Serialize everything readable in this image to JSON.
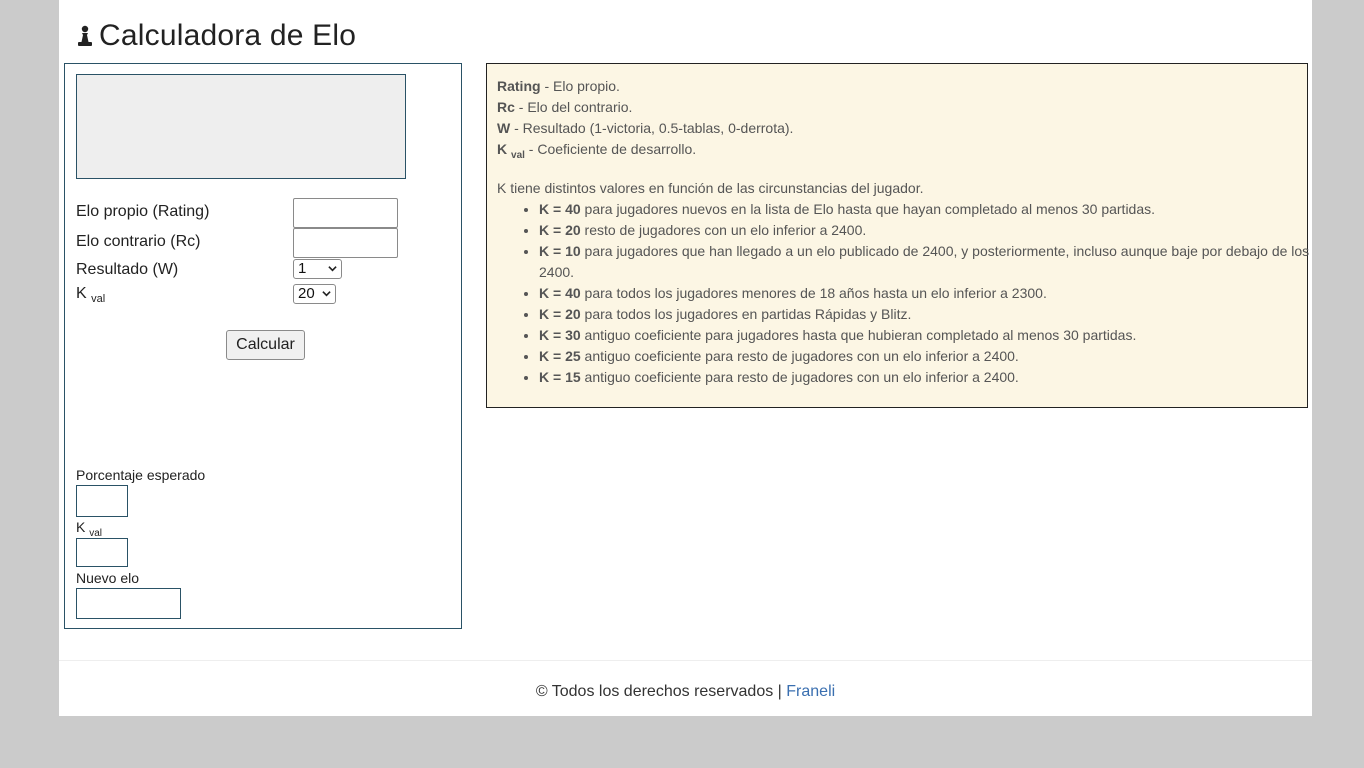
{
  "header": {
    "title": "Calculadora de Elo",
    "icon": "chess-pawn-icon"
  },
  "form": {
    "rating_label": "Elo propio (Rating)",
    "rating_value": "",
    "rc_label": "Elo contrario (Rc)",
    "rc_value": "",
    "w_label": "Resultado (W)",
    "w_selected": "1",
    "k_label": "K",
    "k_sub": "val",
    "k_selected": "20",
    "calc_button": "Calcular"
  },
  "results": {
    "expected_label": "Porcentaje esperado",
    "expected_value": "",
    "k_label": "K",
    "k_sub": "val",
    "k_value": "",
    "new_elo_label": "Nuevo elo",
    "new_elo_value": ""
  },
  "info": {
    "definitions": [
      {
        "term": "Rating",
        "sub": "",
        "desc": " - Elo propio."
      },
      {
        "term": "Rc",
        "sub": "",
        "desc": " - Elo del contrario."
      },
      {
        "term": "W",
        "sub": "",
        "desc": " - Resultado (1-victoria, 0.5-tablas, 0-derrota)."
      },
      {
        "term": "K",
        "sub": "val",
        "desc": " - Coeficiente de desarrollo."
      }
    ],
    "k_intro": "K tiene distintos valores en función de las circunstancias del jugador.",
    "k_values": [
      {
        "k": "K = 40",
        "text": " para jugadores nuevos en la lista de Elo hasta que hayan completado al menos 30 partidas."
      },
      {
        "k": "K = 20",
        "text": " resto de jugadores con un elo inferior a 2400."
      },
      {
        "k": "K = 10",
        "text": " para jugadores que han llegado a un elo publicado de 2400, y posteriormente, incluso aunque baje por debajo de los 2400."
      },
      {
        "k": "K = 40",
        "text": " para todos los jugadores menores de 18 años hasta un elo inferior a 2300."
      },
      {
        "k": "K = 20",
        "text": " para todos los jugadores en partidas Rápidas y Blitz."
      },
      {
        "k": "K = 30",
        "text": " antiguo coeficiente para jugadores hasta que hubieran completado al menos 30 partidas."
      },
      {
        "k": "K = 25",
        "text": " antiguo coeficiente para resto de jugadores con un elo inferior a 2400."
      },
      {
        "k": "K = 15",
        "text": " antiguo coeficiente para resto de jugadores con un elo inferior a 2400."
      }
    ]
  },
  "footer": {
    "copyright": "© Todos los derechos reservados | ",
    "link_text": "Franeli"
  },
  "colors": {
    "page_bg": "#cbcbcb",
    "info_bg": "#fcf6e4",
    "border_accent": "#2a5266",
    "link": "#3a6fb0"
  }
}
